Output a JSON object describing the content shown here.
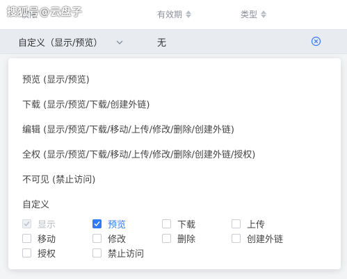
{
  "watermark": "搜狐号@云盘子",
  "table": {
    "columns": [
      "权限",
      "有效期",
      "类型"
    ],
    "row": {
      "permission": "自定义（显示/预览）",
      "validity": "无"
    }
  },
  "dropdown": {
    "options": [
      "预览 (显示/预览)",
      "下载 (显示/预览/下载/创建外链)",
      "编辑 (显示/预览/下载/移动/上传/修改/删除/创建外链)",
      "全权 (显示/预览/下载/移动/上传/修改/删除/创建外链/授权)",
      "不可见 (禁止访问)"
    ],
    "custom_label": "自定义",
    "checkboxes": [
      {
        "label": "显示",
        "checked": true,
        "disabled": true
      },
      {
        "label": "预览",
        "checked": true,
        "disabled": false
      },
      {
        "label": "下载",
        "checked": false,
        "disabled": false
      },
      {
        "label": "上传",
        "checked": false,
        "disabled": false
      },
      {
        "label": "移动",
        "checked": false,
        "disabled": false
      },
      {
        "label": "修改",
        "checked": false,
        "disabled": false
      },
      {
        "label": "删除",
        "checked": false,
        "disabled": false
      },
      {
        "label": "创建外链",
        "checked": false,
        "disabled": false
      },
      {
        "label": "授权",
        "checked": false,
        "disabled": false
      },
      {
        "label": "禁止访问",
        "checked": false,
        "disabled": false
      }
    ]
  },
  "colors": {
    "accent": "#2f7bf6",
    "row_bg": "#e8ebf0",
    "header_text": "#8a8f99"
  },
  "icons": {
    "sort": "sort-icon",
    "chevron": "chevron-down-icon",
    "clear": "close-circle-icon",
    "check": "checkmark-icon"
  }
}
